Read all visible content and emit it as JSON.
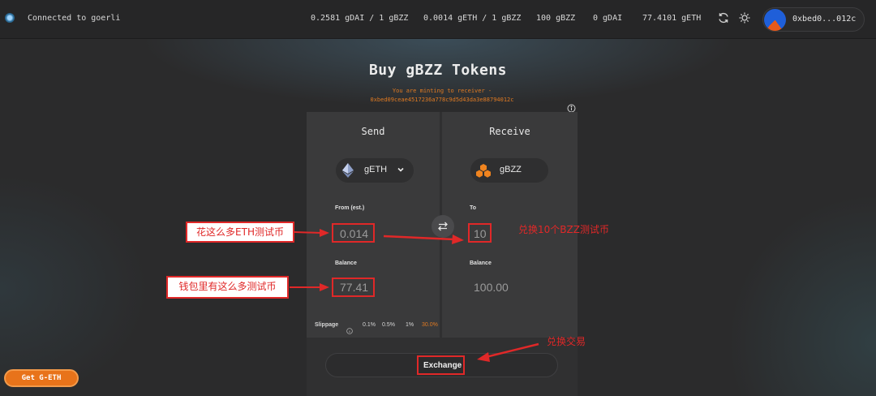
{
  "header": {
    "network": "Connected to goerli",
    "rate_dai": "0.2581 gDAI / 1 gBZZ",
    "rate_eth": "0.0014 gETH / 1 gBZZ",
    "balance_bzz": "100 gBZZ",
    "balance_dai": "0 gDAI",
    "balance_eth": "77.4101 gETH",
    "account": "0xbed0...012c"
  },
  "main": {
    "title": "Buy gBZZ Tokens",
    "mint_note_line1": "You are minting to receiver -",
    "mint_note_line2": "0xbed09ceae4517236a778c9d5d43da3e88794012c"
  },
  "send": {
    "title": "Send",
    "token": "gETH",
    "from_label": "From (est.)",
    "from_value": "0.014",
    "balance_label": "Balance",
    "balance_value": "77.41",
    "slippage_label": "Slippage",
    "slippage_options": [
      "0.1%",
      "0.5%",
      "1%",
      "30.0%"
    ]
  },
  "receive": {
    "title": "Receive",
    "token": "gBZZ",
    "to_label": "To",
    "to_value": "10",
    "balance_label": "Balance",
    "balance_value": "100.00"
  },
  "actions": {
    "exchange": "Exchange",
    "get_eth": "Get G-ETH"
  },
  "annotations": {
    "spend_eth": "花这么多ETH测试币",
    "wallet_balance": "钱包里有这么多测试币",
    "receive_bzz": "兑换10个BZZ测试币",
    "exchange_tx": "兑换交易"
  },
  "colors": {
    "accent": "#e8731a",
    "annotation": "#e02828",
    "background": "#2b2b2c"
  }
}
